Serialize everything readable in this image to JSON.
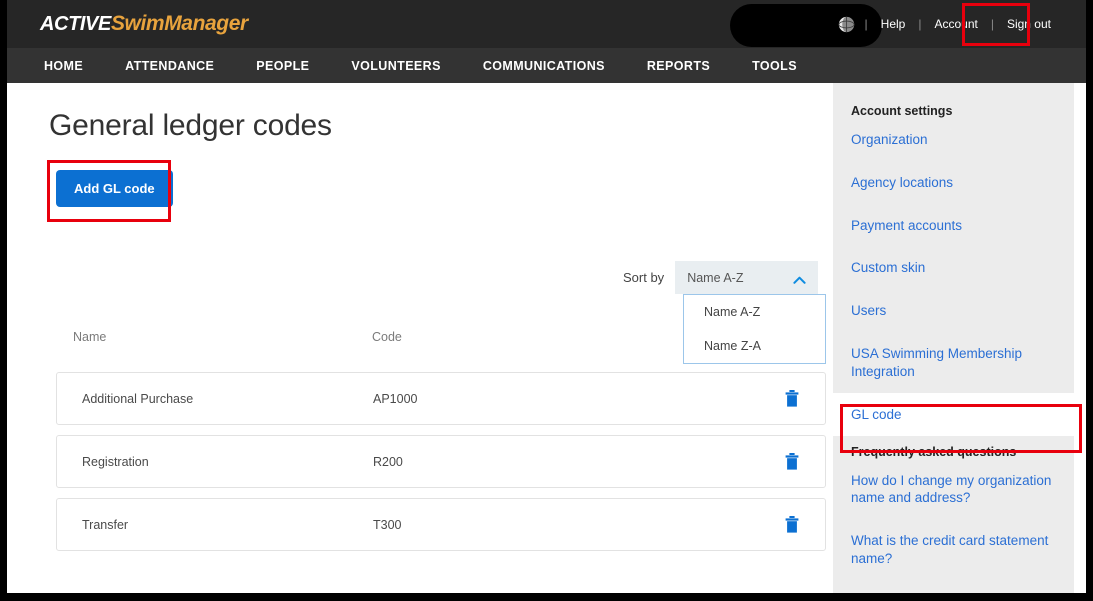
{
  "header": {
    "logo_active": "ACTIVE",
    "logo_product": "SwimManager",
    "globe_icon": "globe-icon",
    "separator": "|",
    "help_label": "Help",
    "account_label": "Account",
    "signout_label": "Sign out",
    "redacted_region": true
  },
  "nav": {
    "items": [
      {
        "label": "HOME"
      },
      {
        "label": "ATTENDANCE"
      },
      {
        "label": "PEOPLE"
      },
      {
        "label": "VOLUNTEERS"
      },
      {
        "label": "COMMUNICATIONS"
      },
      {
        "label": "REPORTS"
      },
      {
        "label": "TOOLS"
      }
    ]
  },
  "main": {
    "title": "General ledger codes",
    "add_button_label": "Add GL code",
    "sort_label": "Sort by",
    "sort_value": "Name A-Z",
    "sort_chevron_icon": "chevron-up-icon",
    "sort_options": [
      {
        "label": "Name A-Z"
      },
      {
        "label": "Name Z-A"
      }
    ],
    "columns": [
      {
        "label": "Name"
      },
      {
        "label": "Code"
      }
    ],
    "rows": [
      {
        "name": "Additional Purchase",
        "code": "AP1000",
        "delete_icon": "trash-icon"
      },
      {
        "name": "Registration",
        "code": "R200",
        "delete_icon": "trash-icon"
      },
      {
        "name": "Transfer",
        "code": "T300",
        "delete_icon": "trash-icon"
      }
    ]
  },
  "sidebar": {
    "account_settings_heading": "Account settings",
    "links": [
      {
        "label": "Organization"
      },
      {
        "label": "Agency locations"
      },
      {
        "label": "Payment accounts"
      },
      {
        "label": "Custom skin"
      },
      {
        "label": "Users"
      },
      {
        "label": "USA Swimming Membership Integration"
      },
      {
        "label": "GL code"
      }
    ],
    "faq_heading": "Frequently asked questions",
    "faq_links": [
      {
        "label": "How do I change my organization name and address?"
      },
      {
        "label": "What is the credit card statement name?"
      }
    ]
  },
  "colors": {
    "header_bg": "#262626",
    "nav_bg": "#333333",
    "brand_orange": "#e8a33d",
    "accent_blue": "#0c70d2",
    "link_blue": "#2b6fd4",
    "highlight_red": "#e8000d",
    "sidebar_bg": "#ececec"
  }
}
